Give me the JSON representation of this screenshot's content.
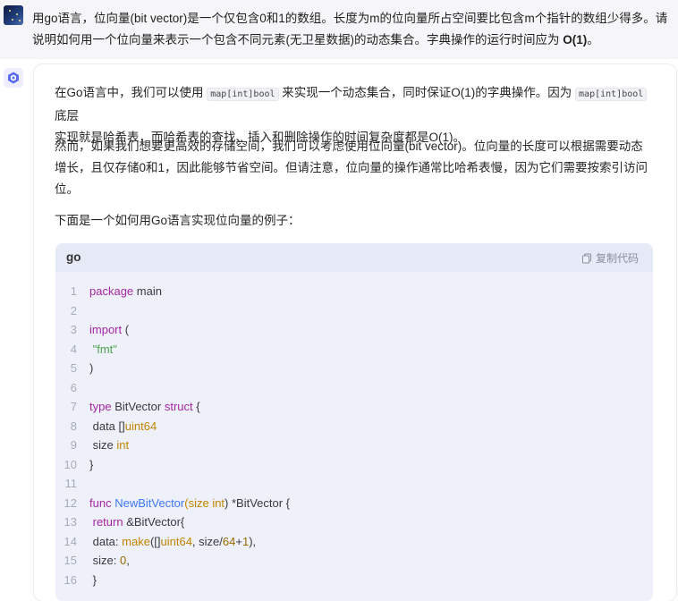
{
  "user_message": {
    "line1": "用go语言，位向量(bit vector)是一个仅包含0和1的数组。长度为m的位向量所占空间要比包含m个指针的数组少得多。请",
    "line2_pre": "说明如何用一个位向量来表示一个包含不同元素(无卫星数据)的动态集合。字典操作的运行时间应为 ",
    "line2_bold": "O(1)",
    "line2_post": "。"
  },
  "answer": {
    "p1_a": "在Go语言中，我们可以使用 ",
    "p1_code1": "map[int]bool",
    "p1_b": " 来实现一个动态集合，同时保证O(1)的字典操作。因为 ",
    "p1_code2": "map[int]bool",
    "p1_c": " 底层",
    "p1_line2": "实现就是哈希表，而哈希表的查找、插入和删除操作的时间复杂度都是O(1)。",
    "p2_line1": "然而，如果我们想要更高效的存储空间，我们可以考虑使用位向量(bit vector)。位向量的长度可以根据需要动态",
    "p2_line2": "增长，且仅存储0和1，因此能够节省空间。但请注意，位向量的操作通常比哈希表慢，因为它们需要按索引访问",
    "p2_line3": "位。",
    "p3": "下面是一个如何用Go语言实现位向量的例子："
  },
  "code_block": {
    "language": "go",
    "copy_label": "复制代码",
    "line_numbers": [
      "1",
      "2",
      "3",
      "4",
      "5",
      "6",
      "7",
      "8",
      "9",
      "10",
      "11",
      "12",
      "13",
      "14",
      "15",
      "16"
    ],
    "l1_kw": "package",
    "l1_rest": " main",
    "l3_kw": "import",
    "l3_rest": " (",
    "l4_pre": " ",
    "l4_str": "\"fmt\"",
    "l5": ")",
    "l7_kw1": "type",
    "l7_name": " BitVector ",
    "l7_kw2": "struct",
    "l7_rest": " {",
    "l8_pre": " data []",
    "l8_ty": "uint64",
    "l9_pre": " size ",
    "l9_ty": "int",
    "l10": "}",
    "l12_kw": "func",
    "l12_sp": " ",
    "l12_fn": "NewBitVector",
    "l12_a": "(size ",
    "l12_ty": "int",
    "l12_b": ") *BitVector {",
    "l13_pre": " ",
    "l13_kw": "return",
    "l13_rest": " &BitVector{",
    "l14_a": " data: ",
    "l14_fn": "make",
    "l14_b": "([]",
    "l14_ty": "uint64",
    "l14_c": ", size/",
    "l14_n1": "64",
    "l14_d": "+",
    "l14_n2": "1",
    "l14_e": "),",
    "l15_a": " size: ",
    "l15_n": "0",
    "l15_b": ",",
    "l16": " }"
  }
}
